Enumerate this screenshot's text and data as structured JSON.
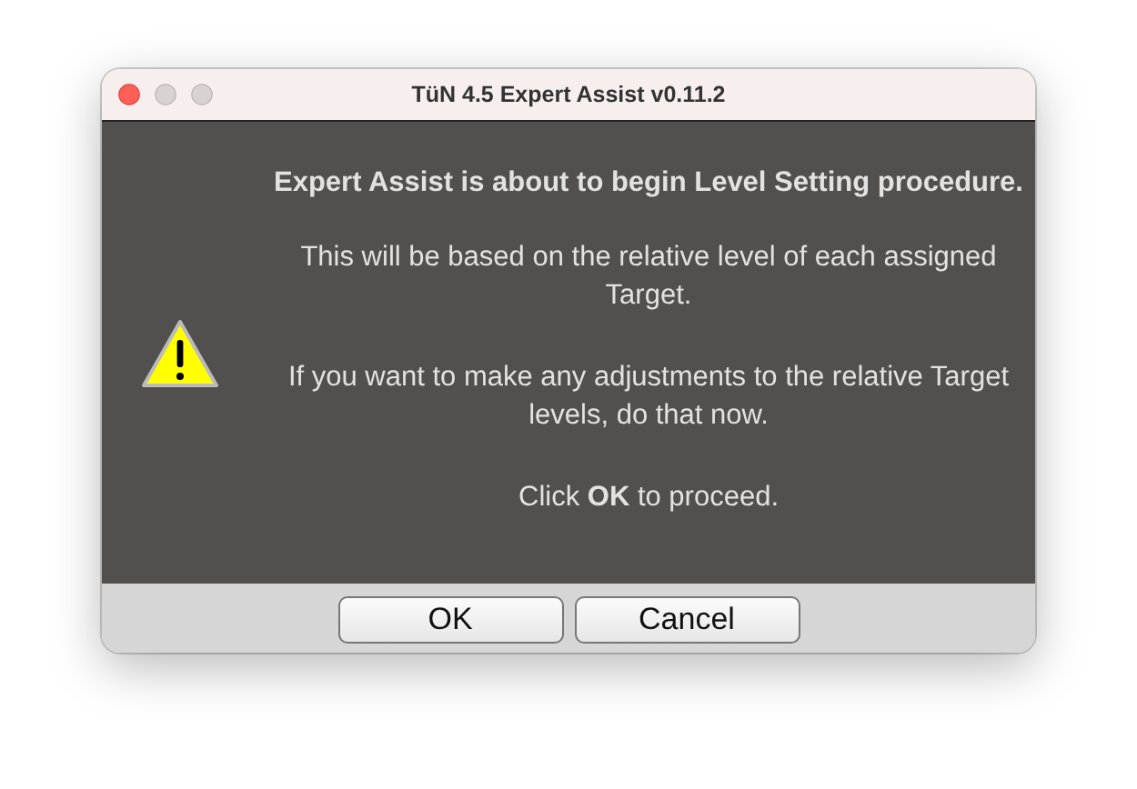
{
  "window": {
    "title": "TüN 4.5 Expert Assist v0.11.2"
  },
  "message": {
    "heading": "Expert Assist is about to begin Level Setting procedure.",
    "paragraphs": [
      "This will be based on the relative level of each assigned Target.",
      "If you want to make any adjustments to the relative Target levels, do that now.",
      "Click **OK** to proceed."
    ]
  },
  "buttons": [
    "OK",
    "Cancel"
  ]
}
